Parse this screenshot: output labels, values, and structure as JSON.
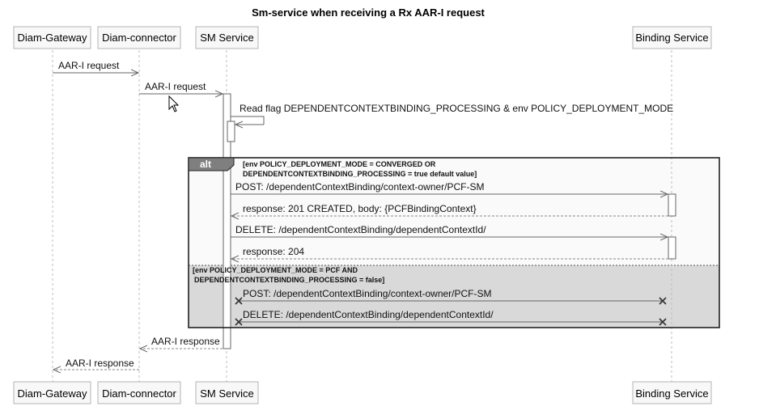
{
  "title": "Sm-service when receiving a Rx AAR-I request",
  "participants": {
    "gateway": "Diam-Gateway",
    "connector": "Diam-connector",
    "sm": "SM Service",
    "binding": "Binding Service"
  },
  "messages": {
    "aar_req_1": "AAR-I request",
    "aar_req_2": "AAR-I request",
    "read_flag": "Read flag DEPENDENTCONTEXTBINDING_PROCESSING & env POLICY_DEPLOYMENT_MODE",
    "post_1": "POST: /dependentContextBinding/context-owner/PCF-SM",
    "resp_201": "response: 201 CREATED, body: {PCFBindingContext}",
    "delete_1": "DELETE: /dependentContextBinding/dependentContextId/",
    "resp_204": "response: 204",
    "post_2": "POST: /dependentContextBinding/context-owner/PCF-SM",
    "delete_2": "DELETE: /dependentContextBinding/dependentContextId/",
    "aar_resp_1": "AAR-I response",
    "aar_resp_2": "AAR-I response"
  },
  "alt": {
    "label": "alt",
    "guard_1_line1": "[env POLICY_DEPLOYMENT_MODE = CONVERGED OR",
    "guard_1_line2": "DEPENDENTCONTEXTBINDING_PROCESSING = true default value]",
    "guard_2_line1": "[env POLICY_DEPLOYMENT_MODE = PCF AND",
    "guard_2_line2": "DEPENDENTCONTEXTBINDING_PROCESSING = false]"
  }
}
